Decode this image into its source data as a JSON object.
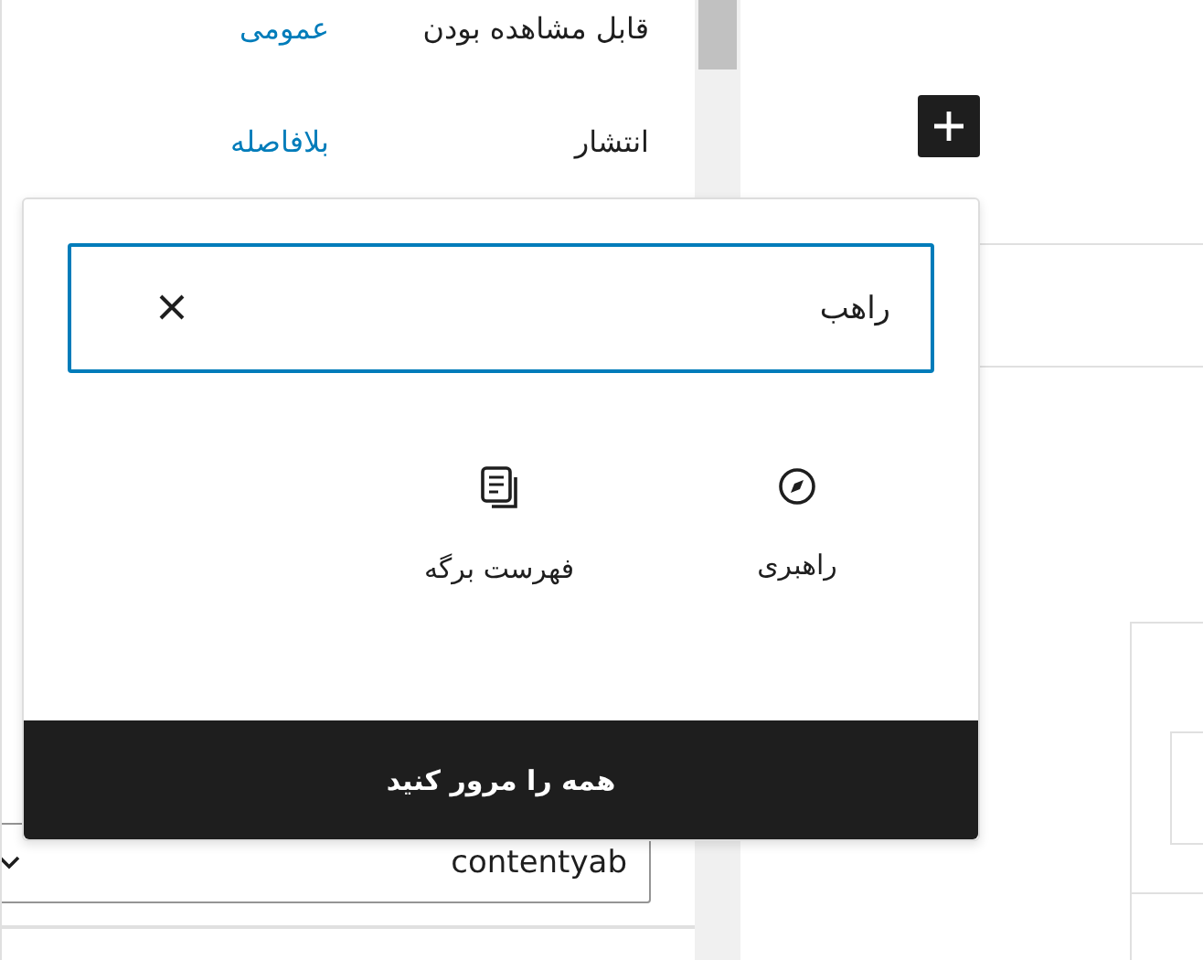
{
  "sidebar": {
    "rows": [
      {
        "label": "قابل مشاهده بودن",
        "value": "عمومی"
      },
      {
        "label": "انتشار",
        "value": "بلافاصله"
      }
    ],
    "author_select": {
      "value": "contentyab"
    }
  },
  "inserter": {
    "search": {
      "value": "راهب"
    },
    "results": [
      {
        "label": "راهبری",
        "kind": "compass"
      },
      {
        "label": "فهرست برگه",
        "kind": "pages"
      }
    ],
    "browse_all": "همه را مرور کنید"
  }
}
